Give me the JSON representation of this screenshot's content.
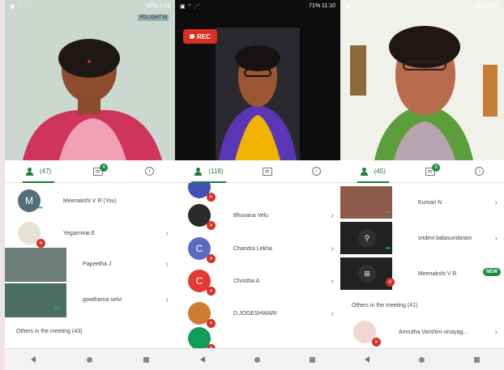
{
  "panels": [
    {
      "status": {
        "left": "▣ ⌔ ⋰",
        "right": "92% 9:46"
      },
      "caption_tag": "FDL IGHT M",
      "tabs": {
        "participants": "(47)",
        "chat_badge": "4",
        "info": "i"
      },
      "rows": [
        {
          "name": "Meenakshi V R (You)",
          "avatar": "M",
          "avatar_color": "#546e7a",
          "mute": false,
          "dots": "•••"
        },
        {
          "name": "Yegammai E",
          "avatar": "",
          "avatar_color": "#e6e0d8",
          "mute": true
        },
        {
          "name": "Papeetha J",
          "avatar": "",
          "avatar_color": "#6c7d7a",
          "mute": false,
          "dots": "•••"
        },
        {
          "name": "gowthama selvi",
          "avatar": "",
          "avatar_color": "#4c6f62",
          "mute": false,
          "dots": "•••"
        }
      ],
      "section": "Others in the meeting (43)"
    },
    {
      "status": {
        "left": "▣ ⌔ ⋰",
        "right": "71% 11:10"
      },
      "rec_label": "REC",
      "tabs": {
        "participants": "(118)",
        "info": "i"
      },
      "rows": [
        {
          "name": "Bhuvana Velu",
          "avatar": "",
          "avatar_color": "#2b2b2b",
          "mute": true
        },
        {
          "name": "Chandra Lekha",
          "avatar": "C",
          "avatar_color": "#5c6bc0",
          "mute": true
        },
        {
          "name": "Christha A",
          "avatar": "C",
          "avatar_color": "#e53935",
          "mute": true
        },
        {
          "name": "D.JOGESHWARI",
          "avatar": "",
          "avatar_color": "#d17a34",
          "mute": true
        }
      ]
    },
    {
      "status": {
        "left": "▣ ⌔ ⋰",
        "right": "91% 9:52"
      },
      "tabs": {
        "participants": "(45)",
        "chat_badge": "9",
        "info": "i"
      },
      "rows": [
        {
          "name": "Kumari N",
          "avatar": "",
          "avatar_color": "#8d5b4a",
          "mute": false
        },
        {
          "name": "sridevi balasundaram",
          "avatar": "",
          "avatar_color": "#222",
          "mute": false
        },
        {
          "name": "Meenakshi V R",
          "avatar": "",
          "avatar_color": "#222",
          "mute": true,
          "badge": "NEW"
        },
        {
          "name": "Amrutha Varshini vinayag...",
          "avatar": "",
          "avatar_color": "#f0d7cf",
          "mute": true
        }
      ],
      "section": "Others in the meeting (41)"
    }
  ],
  "icons": {
    "chevron": "›",
    "mic_off": "✕",
    "pin": "⚲",
    "cast": "⊞"
  },
  "colors": {
    "accent": "#188038",
    "record_red": "#d93025",
    "background": "#efe3ea"
  }
}
